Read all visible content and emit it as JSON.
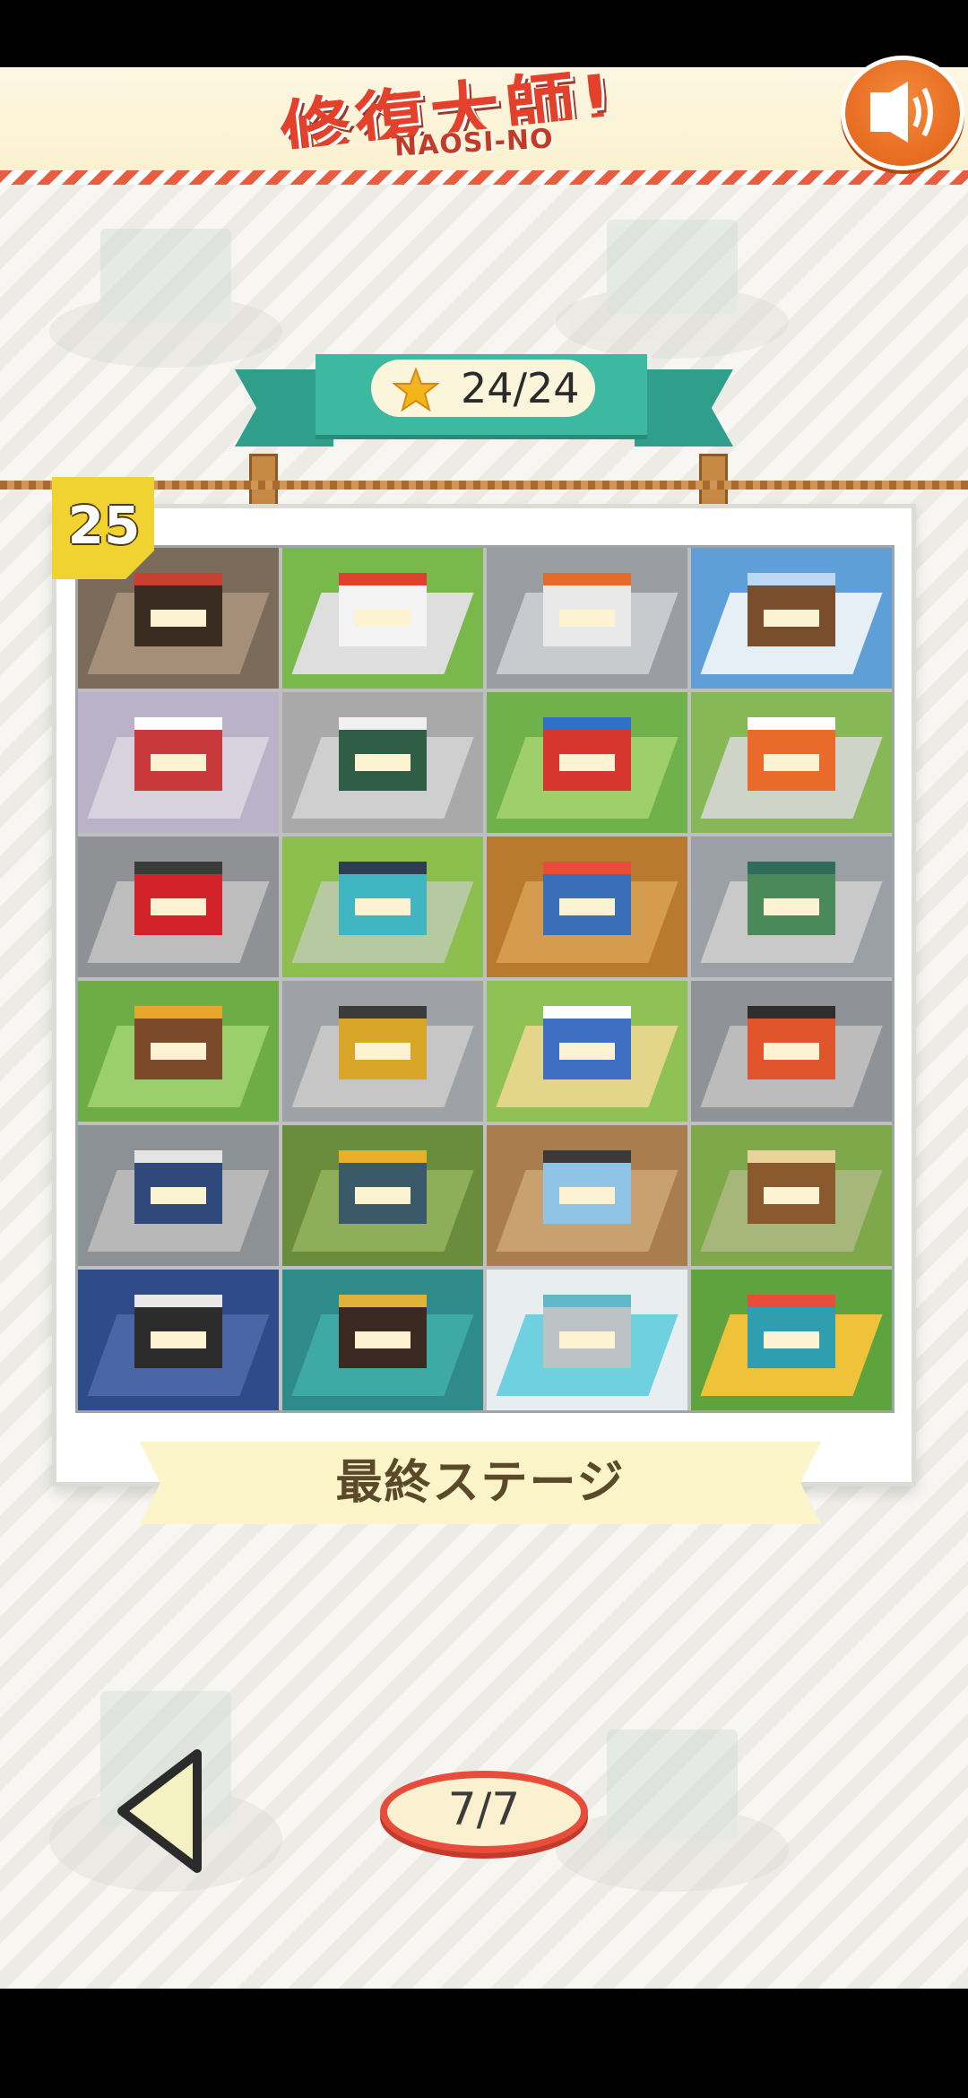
{
  "header": {
    "logo_jp": "修復大師!",
    "logo_en": "NAOSI-NO",
    "sound_icon": "speaker-icon"
  },
  "stars": {
    "count": "24/24",
    "icon": "star-icon"
  },
  "stage": {
    "number": "25",
    "title": "最終ステージ",
    "completed_tiles": 24
  },
  "pagination": {
    "label": "7/7",
    "back_icon": "triangle-left-icon"
  },
  "colors": {
    "accent_red": "#e84c3b",
    "ribbon_teal": "#3cb9a0",
    "badge_yellow": "#f0d230",
    "sound_orange": "#f0731f"
  }
}
